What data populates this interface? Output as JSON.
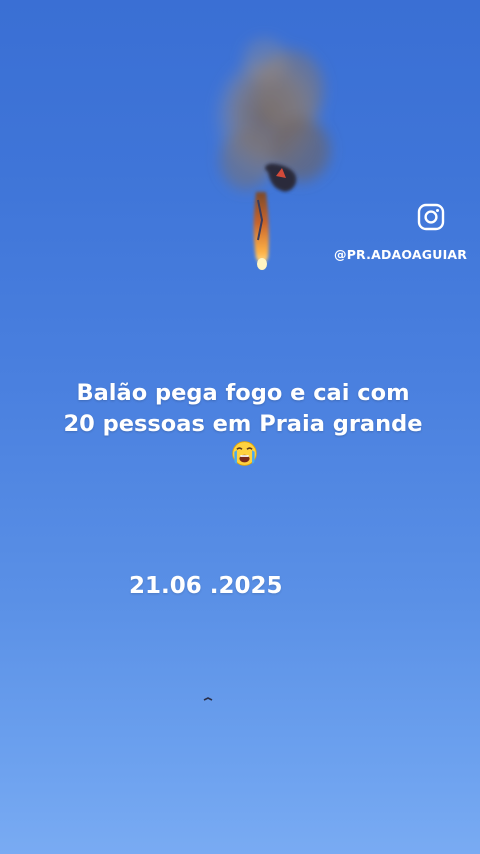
{
  "overlay": {
    "handle": "@PR.ADAOAGUIAR",
    "caption_text": "Balão pega fogo e cai com 20 pessoas em Praia grande",
    "caption_emoji": "loudly-crying-face",
    "date": "21.06 .2025"
  },
  "icons": {
    "social": "instagram-icon"
  },
  "colors": {
    "sky_top": "#3a6fd4",
    "sky_bottom": "#79abf3",
    "text": "#ffffff",
    "smoke": "#8a7d78",
    "fire": "#ffb347"
  }
}
